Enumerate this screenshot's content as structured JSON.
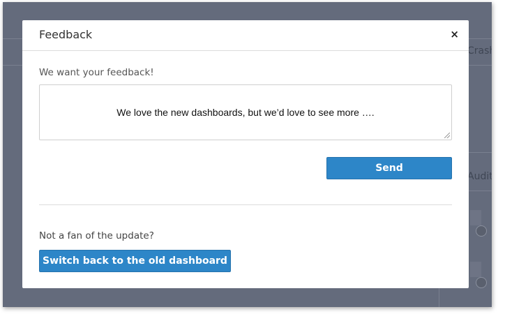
{
  "background": {
    "right_labels": [
      "Crash",
      "Audit"
    ]
  },
  "modal": {
    "title": "Feedback",
    "close_label": "×",
    "prompt": "We want your feedback!",
    "feedback_text": "We love the new dashboards, but we’d love to see more ….",
    "send_label": "Send",
    "not_fan_text": "Not a fan of the update?",
    "switch_label": "Switch back to the old dashboard"
  },
  "colors": {
    "overlay": "#646b7c",
    "primary_button": "#2d86c8"
  }
}
